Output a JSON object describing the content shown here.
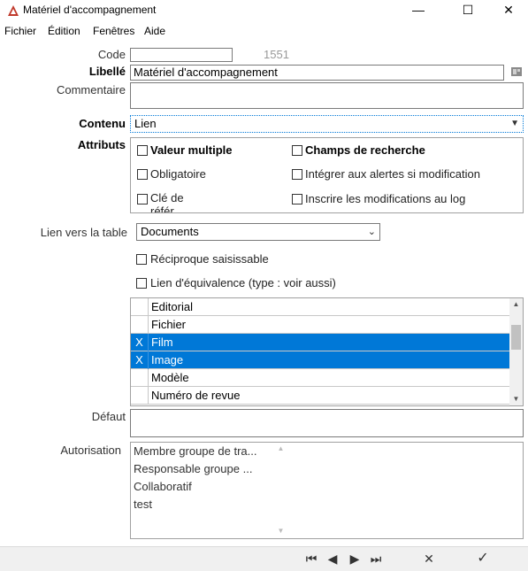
{
  "window": {
    "title": "Matériel d'accompagnement",
    "minimize_glyph": "—",
    "maximize_glyph": "☐",
    "close_glyph": "✕"
  },
  "menu": {
    "file": "Fichier",
    "edit": "Édition",
    "windows": "Fenêtres",
    "help": "Aide"
  },
  "form": {
    "code_label": "Code",
    "code_value": "",
    "code_number": "1551",
    "libelle_label": "Libellé",
    "libelle_value": "Matériel d'accompagnement",
    "commentaire_label": "Commentaire",
    "commentaire_value": "",
    "contenu_label": "Contenu",
    "contenu_value": "Lien",
    "attributs_label": "Attributs",
    "attributes": {
      "valeur_multiple": "Valeur multiple",
      "champs_recherche": "Champs de recherche",
      "obligatoire": "Obligatoire",
      "integrer_alertes": "Intégrer aux alertes si modification",
      "cle_de": "Clé de",
      "cle_de_cont": "référ...",
      "inscrire_log": "Inscrire les modifications au log"
    },
    "lien_table_label": "Lien vers la table",
    "lien_table_value": "Documents",
    "reciproque": "Réciproque saisissable",
    "lien_equivalence": "Lien d'équivalence (type : voir aussi)",
    "defaut_label": "Défaut",
    "defaut_value": "",
    "autorisation_label": "Autorisation"
  },
  "type_list": [
    {
      "mark": "",
      "label": "Editorial",
      "selected": false
    },
    {
      "mark": "",
      "label": "Fichier",
      "selected": false
    },
    {
      "mark": "X",
      "label": "Film",
      "selected": true
    },
    {
      "mark": "X",
      "label": "Image",
      "selected": true
    },
    {
      "mark": "",
      "label": "Modèle",
      "selected": false
    },
    {
      "mark": "",
      "label": "Numéro de revue",
      "selected": false
    }
  ],
  "autorisation_list": [
    "Membre groupe de tra...",
    "Responsable groupe ...",
    "Collaboratif",
    "test"
  ],
  "nav": {
    "first": "⏮",
    "prev": "◀",
    "next": "▶",
    "last": "⏭",
    "cancel": "✕",
    "ok": "✓"
  },
  "colors": {
    "selection": "#0078d7",
    "accent_icon": "#c0392b"
  }
}
